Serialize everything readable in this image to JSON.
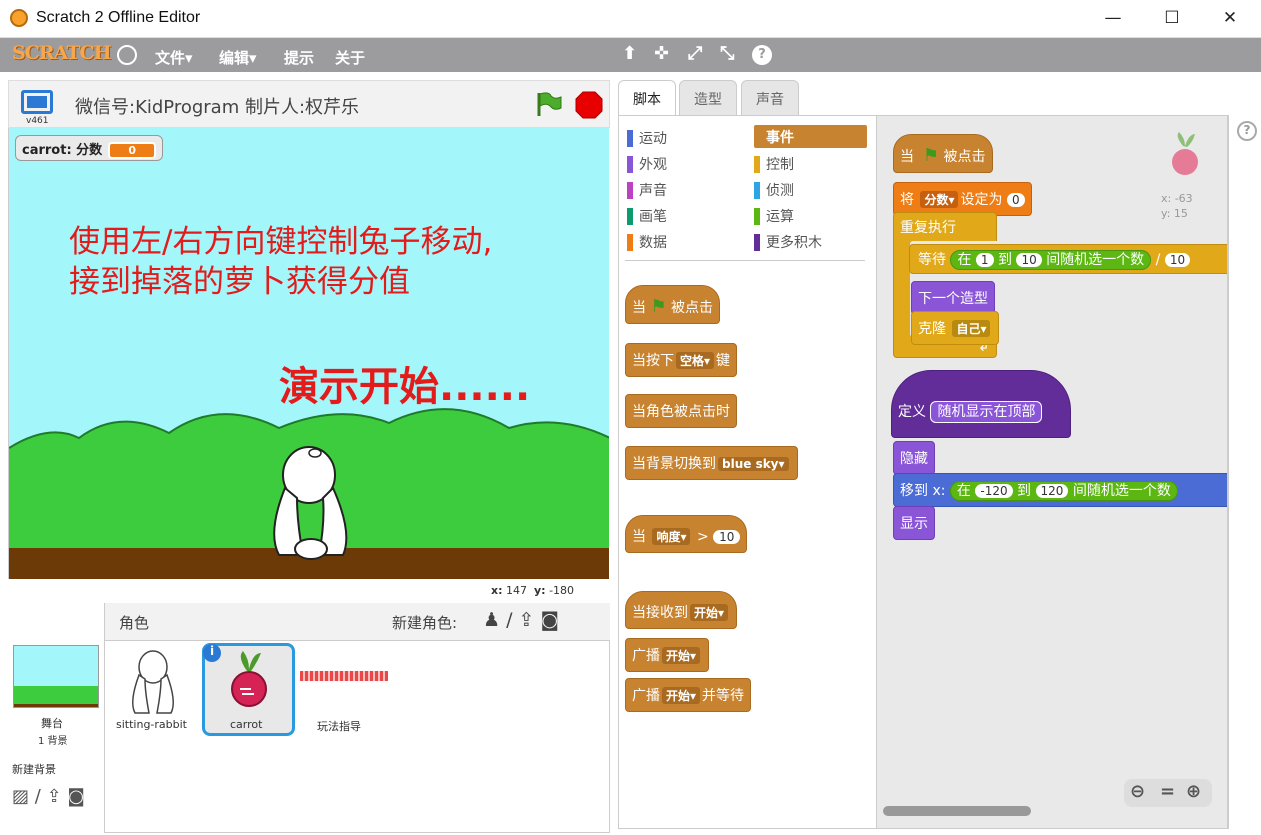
{
  "window": {
    "title": "Scratch 2 Offline Editor",
    "min": "—",
    "max": "☐",
    "close": "✕"
  },
  "menubar": {
    "logo": "SCRATCH",
    "items": [
      "文件▾",
      "编辑▾",
      "提示",
      "关于"
    ],
    "tools": [
      "⬆",
      "✜",
      "⤢",
      "⤡",
      "?"
    ]
  },
  "stage": {
    "version": "v461",
    "project_title": "微信号:KidProgram 制片人:权芹乐",
    "variable": {
      "label": "carrot: 分数",
      "value": "0"
    },
    "text_line1": "使用左/右方向键控制兔子移动,",
    "text_line2": "接到掉落的萝卜获得分值",
    "text_big": "演示开始......",
    "coords": {
      "x_label": "x:",
      "x": "147",
      "y_label": "y:",
      "y": "-180"
    }
  },
  "sprites_pane": {
    "header": "角色",
    "new_sprite": "新建角色:",
    "stage_label": "舞台",
    "stage_bg_count": "1 背景",
    "new_backdrop": "新建背景",
    "sprites": [
      {
        "name": "sitting-rabbit"
      },
      {
        "name": "carrot"
      },
      {
        "name": "玩法指导"
      }
    ]
  },
  "tabs": [
    "脚本",
    "造型",
    "声音"
  ],
  "categories": {
    "left": [
      {
        "label": "运动",
        "color": "#4a6cd4"
      },
      {
        "label": "外观",
        "color": "#8a55d7"
      },
      {
        "label": "声音",
        "color": "#bb42c3"
      },
      {
        "label": "画笔",
        "color": "#0e9a6c"
      },
      {
        "label": "数据",
        "color": "#ee7d16"
      }
    ],
    "right": [
      {
        "label": "事件",
        "color": "#c88330"
      },
      {
        "label": "控制",
        "color": "#e1a91a"
      },
      {
        "label": "侦测",
        "color": "#2ca5e2"
      },
      {
        "label": "运算",
        "color": "#5cb712"
      },
      {
        "label": "更多积木",
        "color": "#632d99"
      }
    ]
  },
  "palette_blocks": {
    "flag_prefix": "当",
    "flag_suffix": "被点击",
    "key_prefix": "当按下",
    "key_value": "空格▾",
    "key_suffix": "键",
    "sprite_clicked": "当角色被点击时",
    "backdrop_prefix": "当背景切换到",
    "backdrop_value": "blue sky▾",
    "loud_prefix": "当",
    "loud_value": "响度▾",
    "loud_op": ">",
    "loud_num": "10",
    "recv_prefix": "当接收到",
    "recv_value": "开始▾",
    "bcast_prefix": "广播",
    "bcast_value": "开始▾",
    "bcastw_prefix": "广播",
    "bcastw_value": "开始▾",
    "bcastw_suffix": "并等待"
  },
  "scripts": {
    "flag_prefix": "当",
    "flag_suffix": "被点击",
    "set_prefix": "将",
    "set_var": "分数▾",
    "set_mid": "设定为",
    "set_val": "0",
    "forever": "重复执行",
    "wait": "等待",
    "rand_in": "在",
    "rand_from": "1",
    "rand_to_word": "到",
    "rand_to": "10",
    "rand_suffix": "间随机选一个数",
    "div": "/",
    "div_num": "10",
    "next_costume": "下一个造型",
    "clone": "克隆",
    "clone_target": "自己▾",
    "define": "定义",
    "define_name": "随机显示在顶部",
    "hide": "隐藏",
    "goto_prefix": "移到 x:",
    "goto_in": "在",
    "goto_from": "-120",
    "goto_to_word": "到",
    "goto_to": "120",
    "goto_suffix": "间随机选一个数",
    "show": "显示",
    "sprite_x": "x: -63",
    "sprite_y": "y: 15"
  },
  "zoom": [
    "⊖",
    "=",
    "⊕"
  ]
}
